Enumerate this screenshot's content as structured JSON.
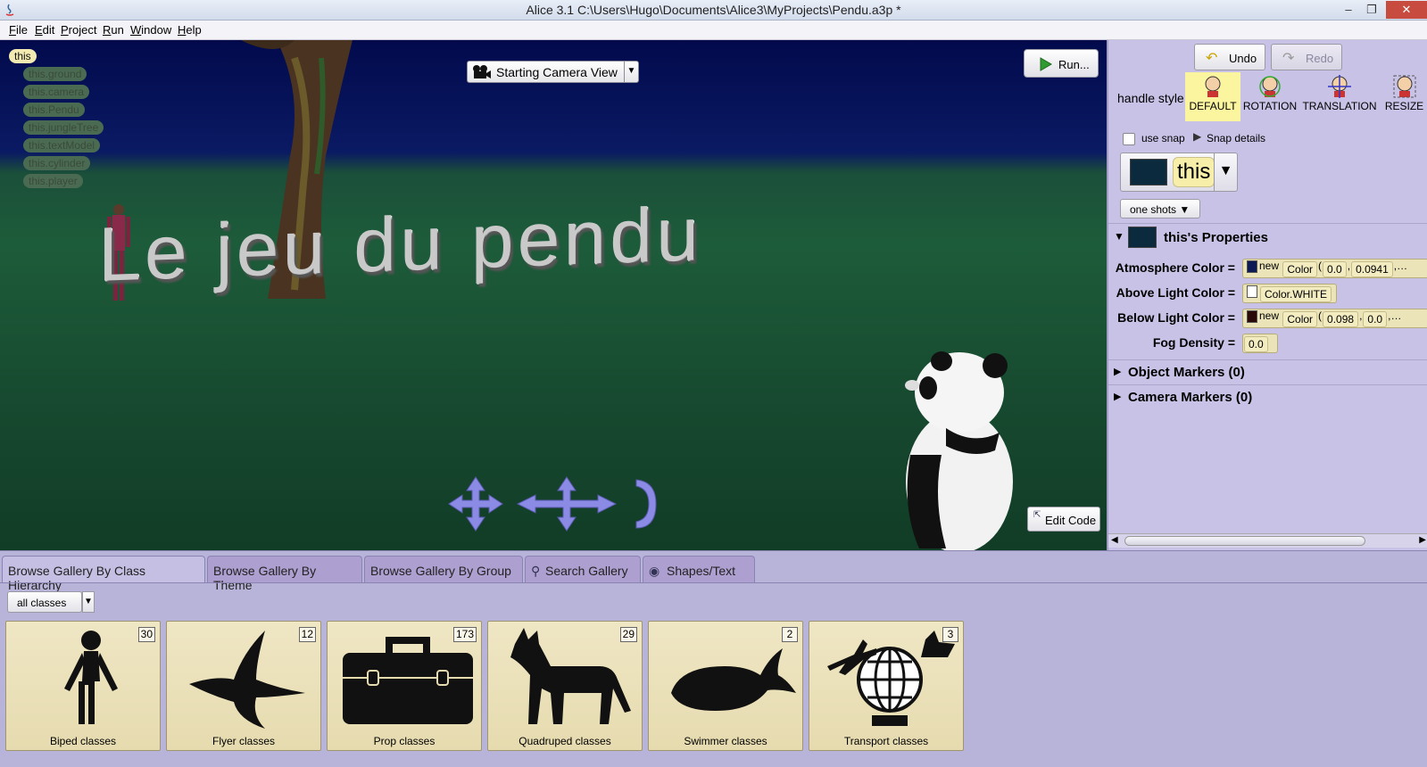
{
  "window": {
    "title": "Alice  3.1 C:\\Users\\Hugo\\Documents\\Alice3\\MyProjects\\Pendu.a3p *",
    "minimize": "–",
    "restore": "❐",
    "close": "✕"
  },
  "menu": [
    {
      "label": "File",
      "key": "F",
      "rest": "ile"
    },
    {
      "label": "Edit",
      "key": "E",
      "rest": "dit"
    },
    {
      "label": "Project",
      "key": "P",
      "rest": "roject"
    },
    {
      "label": "Run",
      "key": "R",
      "rest": "un"
    },
    {
      "label": "Window",
      "key": "W",
      "rest": "indow"
    },
    {
      "label": "Help",
      "key": "H",
      "rest": "elp"
    }
  ],
  "scene": {
    "title_text": "Le jeu du pendu",
    "tree": [
      {
        "label": "this",
        "root": true
      },
      {
        "label": "this.ground"
      },
      {
        "label": "this.camera"
      },
      {
        "label": "this.Pendu"
      },
      {
        "label": "this.jungleTree"
      },
      {
        "label": "this.textModel"
      },
      {
        "label": "this.cylinder"
      },
      {
        "label": "this.player"
      }
    ],
    "camera_view": "Starting Camera View",
    "run_label": "Run...",
    "edit_code_label": "Edit Code"
  },
  "right_panel": {
    "undo_label": "Undo",
    "redo_label": "Redo",
    "handle_style_label": "handle style:",
    "handle_options": [
      {
        "label": "DEFAULT",
        "selected": true
      },
      {
        "label": "ROTATION",
        "selected": false
      },
      {
        "label": "TRANSLATION",
        "selected": false
      },
      {
        "label": "RESIZE",
        "selected": false
      }
    ],
    "use_snap_label": "use snap",
    "use_snap_checked": false,
    "snap_details_label": "Snap details",
    "selected_object": "this",
    "one_shots_label": "one shots ▼",
    "properties_header": "this's Properties",
    "properties": [
      {
        "name": "Atmosphere Color =",
        "swatch": "#0d1b55",
        "parts": [
          "new",
          "Color",
          "(",
          "0.0",
          "0.0941",
          "…"
        ]
      },
      {
        "name": "Above Light Color =",
        "swatch": "#ffffff",
        "parts": [
          "Color.WHITE"
        ]
      },
      {
        "name": "Below Light Color =",
        "swatch": "#2a0a08",
        "parts": [
          "new",
          "Color",
          "(",
          "0.098",
          "0.0",
          "…"
        ]
      },
      {
        "name": "Fog Density =",
        "parts": [
          "0.0"
        ]
      }
    ],
    "object_markers": "Object Markers (0)",
    "camera_markers": "Camera Markers (0)"
  },
  "gallery": {
    "tabs": [
      {
        "label": "Browse Gallery By Class Hierarchy",
        "active": true
      },
      {
        "label": "Browse Gallery By Theme",
        "active": false
      },
      {
        "label": "Browse Gallery By Group",
        "active": false
      },
      {
        "label": "Search Gallery",
        "active": false
      },
      {
        "label": "Shapes/Text",
        "active": false
      }
    ],
    "classes_filter": "all classes",
    "cards": [
      {
        "label": "Biped classes",
        "count": "30"
      },
      {
        "label": "Flyer classes",
        "count": "12"
      },
      {
        "label": "Prop classes",
        "count": "173"
      },
      {
        "label": "Quadruped classes",
        "count": "29"
      },
      {
        "label": "Swimmer classes",
        "count": "2"
      },
      {
        "label": "Transport classes",
        "count": "3"
      }
    ]
  },
  "colors": {
    "panel_bg": "#c7c2e6",
    "gallery_bg": "#b8b3d8",
    "selected_handle": "#fbf5a0",
    "card_bg": "#e6dbaf"
  }
}
